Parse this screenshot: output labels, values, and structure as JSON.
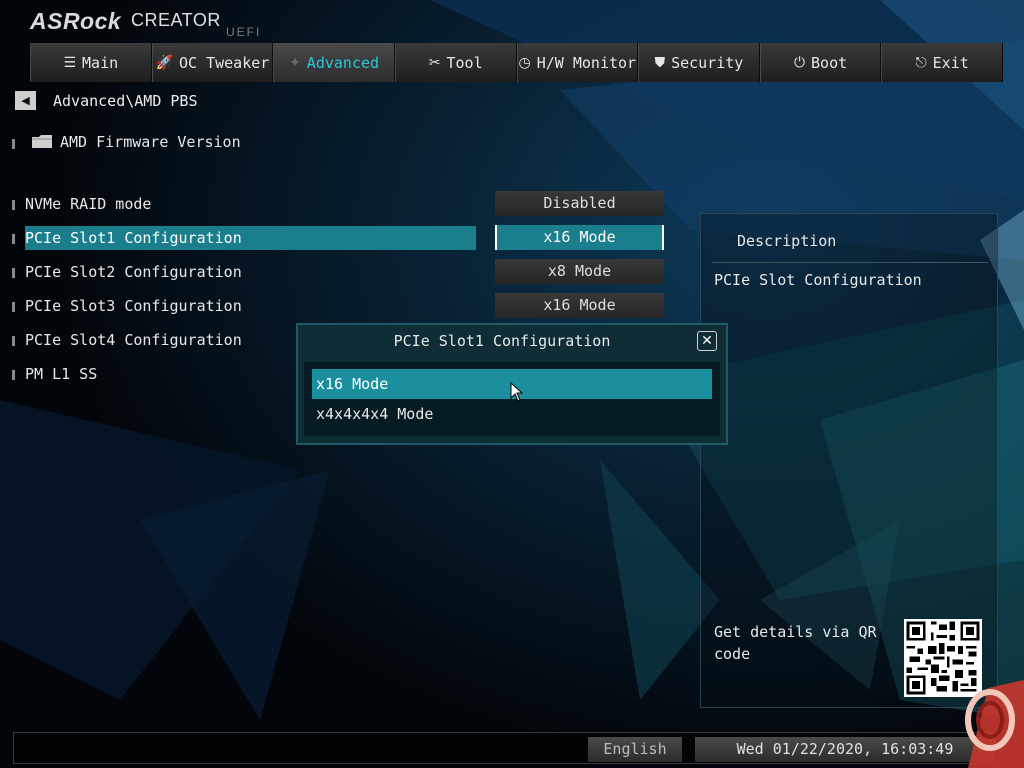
{
  "brand": {
    "name": "ASRock",
    "product": "CREATOR",
    "firmware": "UEFI"
  },
  "nav": {
    "tabs": [
      {
        "label": "Main",
        "icon": "list-icon",
        "active": false
      },
      {
        "label": "OC Tweaker",
        "icon": "rocket-icon",
        "active": false
      },
      {
        "label": "Advanced",
        "icon": "star-icon",
        "active": true
      },
      {
        "label": "Tool",
        "icon": "tools-icon",
        "active": false
      },
      {
        "label": "H/W Monitor",
        "icon": "monitor-icon",
        "active": false
      },
      {
        "label": "Security",
        "icon": "shield-icon",
        "active": false
      },
      {
        "label": "Boot",
        "icon": "power-icon",
        "active": false
      },
      {
        "label": "Exit",
        "icon": "exit-icon",
        "active": false
      }
    ]
  },
  "breadcrumb": {
    "path": "Advanced\\AMD PBS"
  },
  "submenu": {
    "label": "AMD Firmware Version"
  },
  "settings": [
    {
      "label": "NVMe RAID mode",
      "value": "Disabled",
      "selected": false
    },
    {
      "label": "PCIe Slot1 Configuration",
      "value": "x16 Mode",
      "selected": true
    },
    {
      "label": "PCIe Slot2 Configuration",
      "value": "x8 Mode",
      "selected": false
    },
    {
      "label": "PCIe Slot3 Configuration",
      "value": "x16 Mode",
      "selected": false
    },
    {
      "label": "PCIe Slot4 Configuration",
      "value": "",
      "selected": false
    },
    {
      "label": "PM L1 SS",
      "value": "",
      "selected": false
    }
  ],
  "description": {
    "title": "Description",
    "text": "PCIe Slot Configuration",
    "qr_text": "Get details via QR code"
  },
  "popup": {
    "title": "PCIe Slot1 Configuration",
    "options": [
      {
        "label": "x16 Mode",
        "selected": true
      },
      {
        "label": "x4x4x4x4 Mode",
        "selected": false
      }
    ]
  },
  "footer": {
    "language": "English",
    "datetime": "Wed 01/22/2020, 16:03:49"
  },
  "colors": {
    "accent": "#1a7e8c",
    "active_tab_text": "#2ec6d8",
    "background": "#030608"
  }
}
